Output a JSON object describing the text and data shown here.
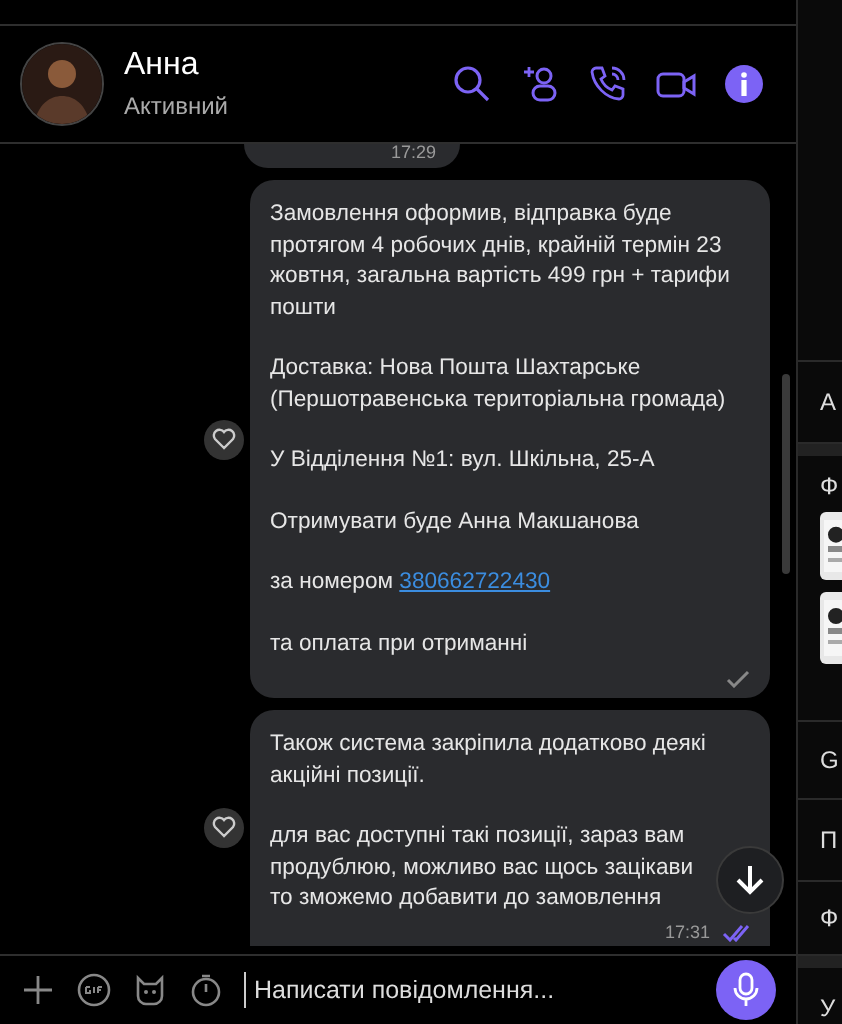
{
  "contact": {
    "name": "Анна",
    "status": "Активний"
  },
  "previous_message": {
    "time": "17:29"
  },
  "messages": [
    {
      "paragraphs": [
        {
          "text": "Замовлення оформив, відправка буде протягом 4 робочих днів, крайній термін 23 жовтня, загальна вартість 499 грн + тарифи пошти"
        },
        {
          "text": "Доставка: Нова Пошта  Шахтарське (Першотравенська територіальна громада)"
        },
        {
          "text": "У Відділення №1: вул. Шкільна, 25-А"
        },
        {
          "text": "Отримувати буде Анна Макшанова"
        },
        {
          "text": "за номером ",
          "link": "380662722430"
        },
        {
          "text": "та оплата при отриманні"
        }
      ],
      "read": false
    },
    {
      "paragraphs": [
        {
          "text": "Також система закріпила додатково деякі акційні позиції."
        },
        {
          "text": "для вас доступні такі позиції, зараз вам продублюю, можливо вас щось зацікави\nто зможемо добавити до замовлення"
        }
      ],
      "time": "17:31",
      "read": true
    }
  ],
  "composer": {
    "placeholder": "Написати повідомлення..."
  },
  "sidebar": {
    "items": [
      {
        "label": "А",
        "kind": "text"
      },
      {
        "label": "Ф",
        "kind": "media"
      },
      {
        "label": "G",
        "kind": "text"
      },
      {
        "label": "П",
        "kind": "text"
      },
      {
        "label": "Ф",
        "kind": "text"
      },
      {
        "label": "У",
        "kind": "text"
      }
    ]
  }
}
